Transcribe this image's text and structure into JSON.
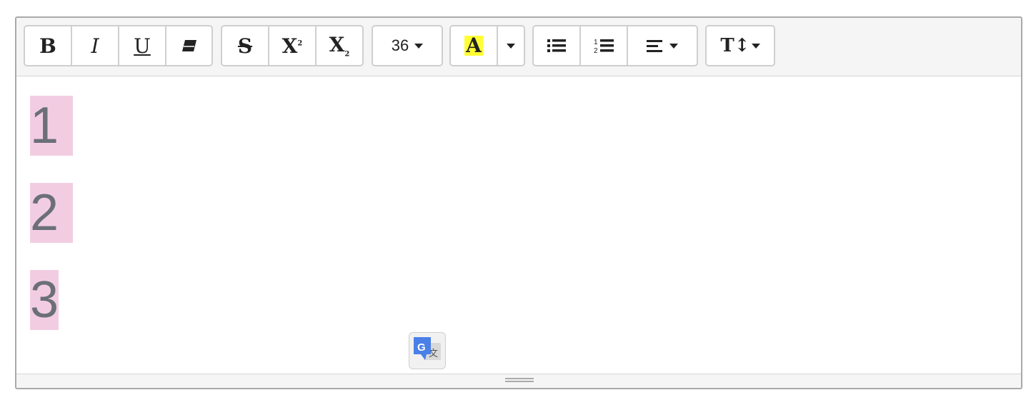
{
  "toolbar": {
    "font_size": "36",
    "highlight_letter": "A",
    "highlight_color": "#ffff33"
  },
  "icons": {
    "bold": "B",
    "italic": "I",
    "underline": "U",
    "eraser": "eraser-icon",
    "strike": "S",
    "superscript": "X",
    "superscript_small": "2",
    "subscript": "X",
    "subscript_small": "2",
    "unordered_list": "unordered-list-icon",
    "ordered_list": "ordered-list-icon",
    "align": "align-icon",
    "line_height": "T↕"
  },
  "content": {
    "lines": [
      "1",
      "2",
      "3"
    ],
    "highlight_color": "#f2cde2"
  },
  "translate_widget": {
    "glyph": "G",
    "char": "文"
  }
}
